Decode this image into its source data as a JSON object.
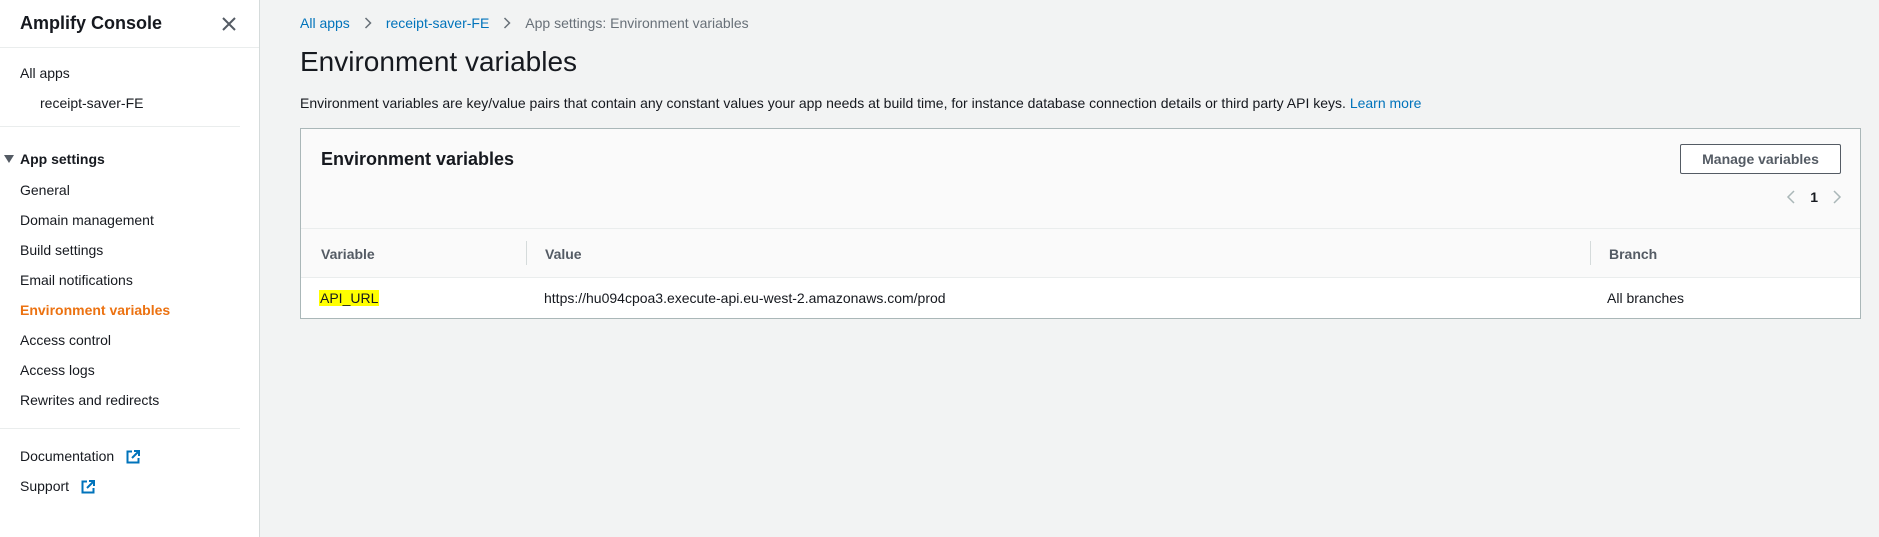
{
  "sidebar": {
    "title": "Amplify Console",
    "all_apps": "All apps",
    "app_name": "receipt-saver-FE",
    "section": "App settings",
    "items": [
      "General",
      "Domain management",
      "Build settings",
      "Email notifications",
      "Environment variables",
      "Access control",
      "Access logs",
      "Rewrites and redirects"
    ],
    "active_item": "Environment variables",
    "documentation": "Documentation",
    "support": "Support"
  },
  "breadcrumb": {
    "all_apps": "All apps",
    "app": "receipt-saver-FE",
    "current": "App settings: Environment variables"
  },
  "page": {
    "title": "Environment variables",
    "description": "Environment variables are key/value pairs that contain any constant values your app needs at build time, for instance database connection details or third party API keys.",
    "learn_more": "Learn more"
  },
  "panel": {
    "title": "Environment variables",
    "manage_button": "Manage variables",
    "page_number": "1",
    "columns": [
      "Variable",
      "Value",
      "Branch"
    ],
    "rows": [
      {
        "variable": "API_URL",
        "value": "https://hu094cpoa3.execute-api.eu-west-2.amazonaws.com/prod",
        "branch": "All branches"
      }
    ]
  },
  "colors": {
    "accent_active": "#ec7211",
    "link": "#0073bb",
    "highlight": "#ffff00"
  },
  "icons": [
    "close-icon",
    "caret-down-icon",
    "external-link-icon",
    "chevron-right-icon",
    "chevron-left-icon"
  ]
}
